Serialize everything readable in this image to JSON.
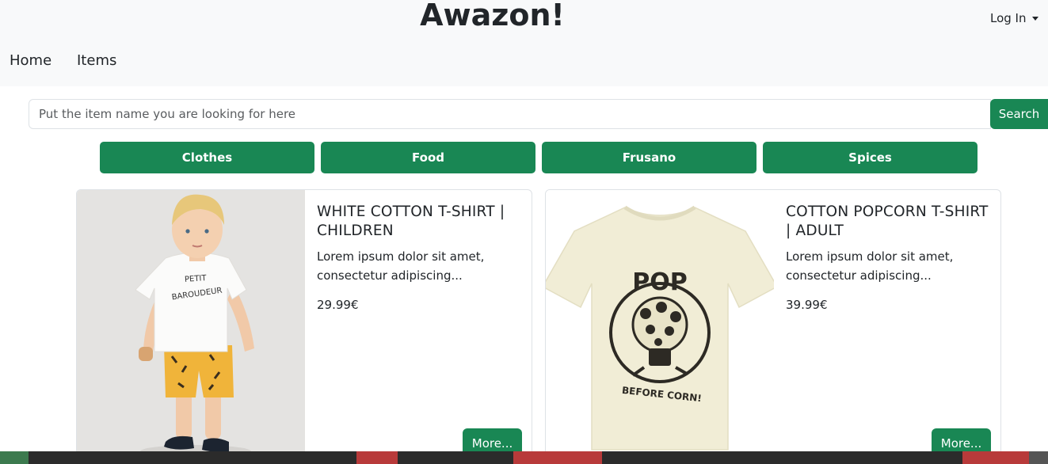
{
  "header": {
    "brand": "Awazon!",
    "login_label": "Log In",
    "nav": [
      {
        "label": "Home"
      },
      {
        "label": "Items"
      }
    ]
  },
  "search": {
    "placeholder": "Put the item name you are looking for here",
    "button_label": "Search"
  },
  "categories": [
    {
      "label": "Clothes"
    },
    {
      "label": "Food"
    },
    {
      "label": "Frusano"
    },
    {
      "label": "Spices"
    }
  ],
  "products": [
    {
      "title": "WHITE COTTON T-SHIRT | CHILDREN",
      "description": "Lorem ipsum dolor sit amet, consectetur adipiscing...",
      "price": "29.99€",
      "button_label": "More..."
    },
    {
      "title": "COTTON POPCORN T-SHIRT | ADULT",
      "description": "Lorem ipsum dolor sit amet, consectetur adipiscing...",
      "price": "39.99€",
      "button_label": "More...",
      "image_text": {
        "top": "POP",
        "bottom": "BEFORE CORN!"
      }
    }
  ],
  "colors": {
    "accent": "#198754",
    "navbar_bg": "#f8f9fa",
    "text": "#212529"
  }
}
